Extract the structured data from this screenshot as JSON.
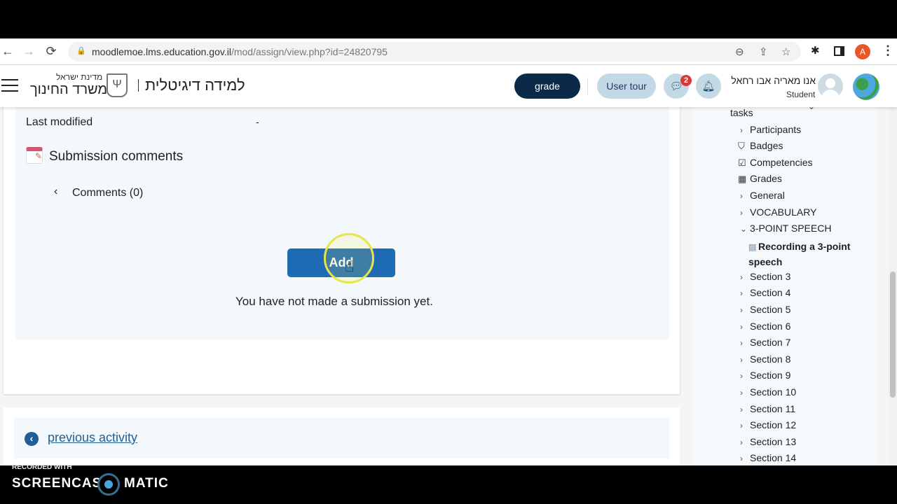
{
  "browser": {
    "url_host": "moodlemoe.lms.education.gov.il",
    "url_path": "/mod/assign/view.php?id=24820795",
    "profile_initial": "A"
  },
  "header": {
    "ministry_top": "מדינת ישראל",
    "ministry_name": "משרד החינוך",
    "site_title": "למידה דיגיטלית",
    "grade_button": "grade",
    "user_tour_button": "User tour",
    "messages_badge": "2",
    "user_name": "אנו מאריה אבו רחאל",
    "user_role": "Student"
  },
  "main": {
    "last_modified_label": "Last modified",
    "last_modified_value": "-",
    "submission_comments_heading": "Submission comments",
    "comments_toggle": "Comments (0)",
    "add_button": "Add",
    "no_submission_text": "You have not made a submission yet.",
    "previous_activity_link": "previous activity"
  },
  "drawer": {
    "items": [
      {
        "label": "tasks",
        "icon": "none"
      },
      {
        "label": "Participants",
        "icon": "chevron-right"
      },
      {
        "label": "Badges",
        "icon": "shield"
      },
      {
        "label": "Competencies",
        "icon": "checkbox"
      },
      {
        "label": "Grades",
        "icon": "table"
      },
      {
        "label": "General",
        "icon": "chevron-right"
      },
      {
        "label": "VOCABULARY",
        "icon": "chevron-right"
      },
      {
        "label": "3-POINT SPEECH",
        "icon": "chevron-down"
      },
      {
        "label": "Recording a 3-point speech",
        "icon": "assignment"
      },
      {
        "label": "Section 3",
        "icon": "chevron-right"
      },
      {
        "label": "Section 4",
        "icon": "chevron-right"
      },
      {
        "label": "Section 5",
        "icon": "chevron-right"
      },
      {
        "label": "Section 6",
        "icon": "chevron-right"
      },
      {
        "label": "Section 7",
        "icon": "chevron-right"
      },
      {
        "label": "Section 8",
        "icon": "chevron-right"
      },
      {
        "label": "Section 9",
        "icon": "chevron-right"
      },
      {
        "label": "Section 10",
        "icon": "chevron-right"
      },
      {
        "label": "Section 11",
        "icon": "chevron-right"
      },
      {
        "label": "Section 12",
        "icon": "chevron-right"
      },
      {
        "label": "Section 13",
        "icon": "chevron-right"
      },
      {
        "label": "Section 14",
        "icon": "chevron-right"
      }
    ]
  },
  "watermark": {
    "line1": "RECORDED WITH",
    "brand_left": "SCREENCAST",
    "brand_right": "MATIC"
  },
  "colors": {
    "primary": "#0f6cbf",
    "dark_navy": "#0b2a4a",
    "pill_bg": "#c4d9e6",
    "badge": "#d9373b"
  }
}
